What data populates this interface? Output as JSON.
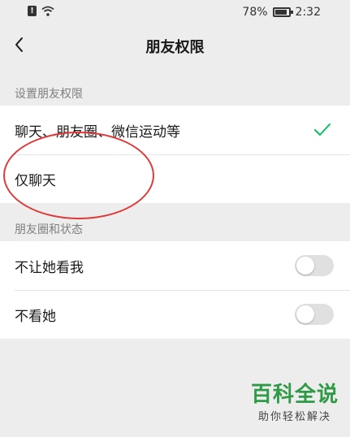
{
  "status_bar": {
    "battery": "78%",
    "time": "2:32",
    "icons": [
      "alert-icon",
      "wifi-icon",
      "battery-icon"
    ]
  },
  "nav": {
    "title": "朋友权限",
    "back_icon": "chevron-left-icon"
  },
  "sections": [
    {
      "label": "设置朋友权限",
      "items": [
        {
          "label": "聊天、朋友圈、微信运动等",
          "selected": true
        },
        {
          "label": "仅聊天",
          "selected": false
        }
      ]
    },
    {
      "label": "朋友圈和状态",
      "items": [
        {
          "label": "不让她看我",
          "toggle": false
        },
        {
          "label": "不看她",
          "toggle": false
        }
      ]
    }
  ],
  "watermark": {
    "title": "百科全说",
    "subtitle": "助你轻松解决"
  },
  "colors": {
    "accent_check": "#07c160",
    "annotation": "#e0393a",
    "watermark": "#2e9a46"
  }
}
